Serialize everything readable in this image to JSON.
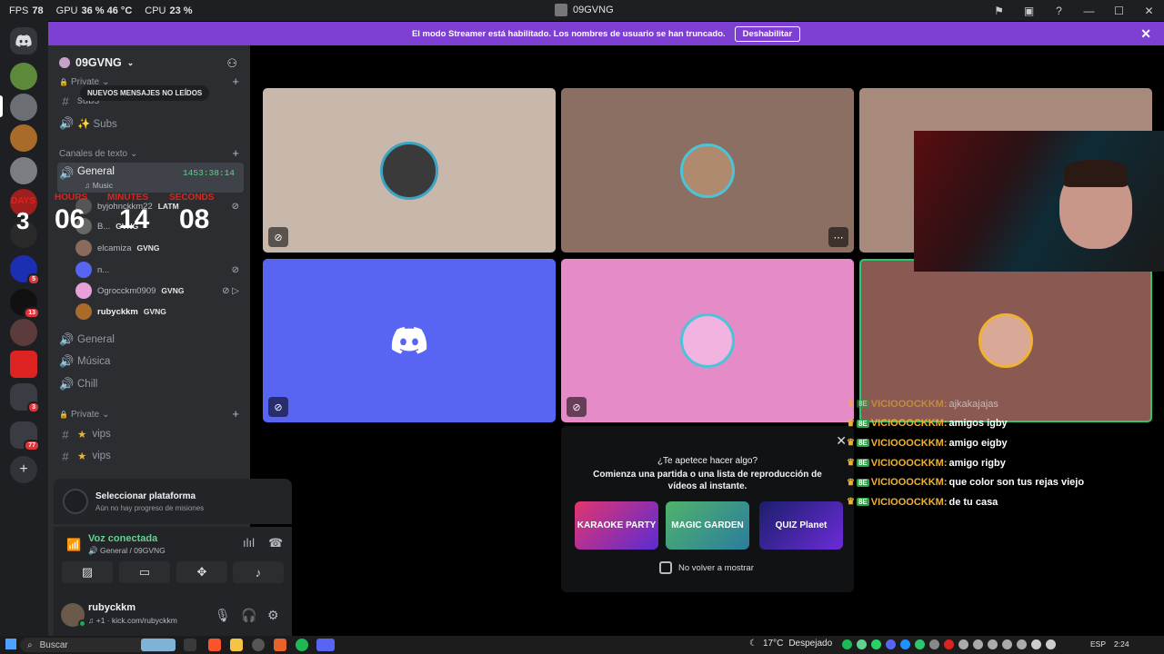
{
  "titlebar": {
    "fps_label": "FPS",
    "fps_value": "78",
    "gpu_label": "GPU",
    "gpu_value": "36 %  46 °C",
    "cpu_label": "CPU",
    "cpu_value": "23 %",
    "window_title": "09GVNG"
  },
  "banner": {
    "text": "El modo Streamer está habilitado. Los nombres de usuario se han truncado.",
    "button": "Deshabilitar"
  },
  "rail": {
    "badges": [
      "5",
      "13",
      "3",
      "77"
    ]
  },
  "sidebar": {
    "guild_name": "09GVNG",
    "new_messages_pill": "NUEVOS MENSAJES NO LEÍDOS",
    "cat_private_top": "Private",
    "chan_subs_text": "subs",
    "chan_subs_voice": "✨ Subs",
    "cat_text_channels": "Canales de texto",
    "chan_general": "General",
    "chan_general_timer": "1453:38:14",
    "chan_general_activity": "Music",
    "voice_users": [
      {
        "name": "byjohnckkm22",
        "tag": "LATM"
      },
      {
        "name": "B...",
        "tag": "GVNG"
      },
      {
        "name": "elcamiza",
        "tag": "GVNG"
      },
      {
        "name": "n...",
        "tag": ""
      },
      {
        "name": "Ogrocckm0909",
        "tag": "GVNG"
      },
      {
        "name": "rubyckkm",
        "tag": "GVNG"
      }
    ],
    "chan_general1": "General",
    "chan_musica": "Música",
    "chan_chill": "Chill",
    "cat_private_bottom": "Private",
    "chan_vips_1": "vips",
    "chan_vips_2": "vips"
  },
  "countdown": {
    "days_label": "DAYS",
    "days": "3",
    "hours_label": "HOURS",
    "hours": "06",
    "minutes_label": "MINUTES",
    "minutes": "14",
    "seconds_label": "SECONDS",
    "seconds": "08"
  },
  "quest": {
    "title": "Seleccionar plataforma",
    "subtitle": "Aún no hay progreso de misiones"
  },
  "voice": {
    "title": "Voz conectada",
    "subtitle": "General / 09GVNG"
  },
  "user": {
    "name": "rubyckkm",
    "status": "+1 · kick.com/rubyckkm"
  },
  "activity": {
    "title": "¿Te apetece hacer algo?",
    "subtitle": "Comienza una partida o una lista de reproducción de vídeos al instante.",
    "games": [
      "KARAOKE PARTY",
      "MAGIC GARDEN",
      "QUIZ Planet"
    ],
    "checkbox_label": "No volver a mostrar"
  },
  "chat": {
    "messages": [
      {
        "user": "VICIOOOCKKM:",
        "text": "ajkakajajas"
      },
      {
        "user": "VICIOOOCKKM:",
        "text": "amigos igby"
      },
      {
        "user": "VICIOOOCKKM:",
        "text": "amigo eigby"
      },
      {
        "user": "VICIOOOCKKM:",
        "text": "amigo rigby"
      },
      {
        "user": "VICIOOOCKKM:",
        "text": "que color son tus rejas viejo"
      },
      {
        "user": "VICIOOOCKKM:",
        "text": "de tu casa"
      }
    ]
  },
  "taskbar": {
    "search": "Buscar",
    "temperature": "17°C",
    "weather": "Despejado",
    "language": "ESP",
    "time": "2:24"
  },
  "colors": {
    "banner": "#7e3fd3",
    "voice_connected": "#5fd38d",
    "countdown_label": "#e0231b",
    "chat_user": "#f0b232"
  }
}
